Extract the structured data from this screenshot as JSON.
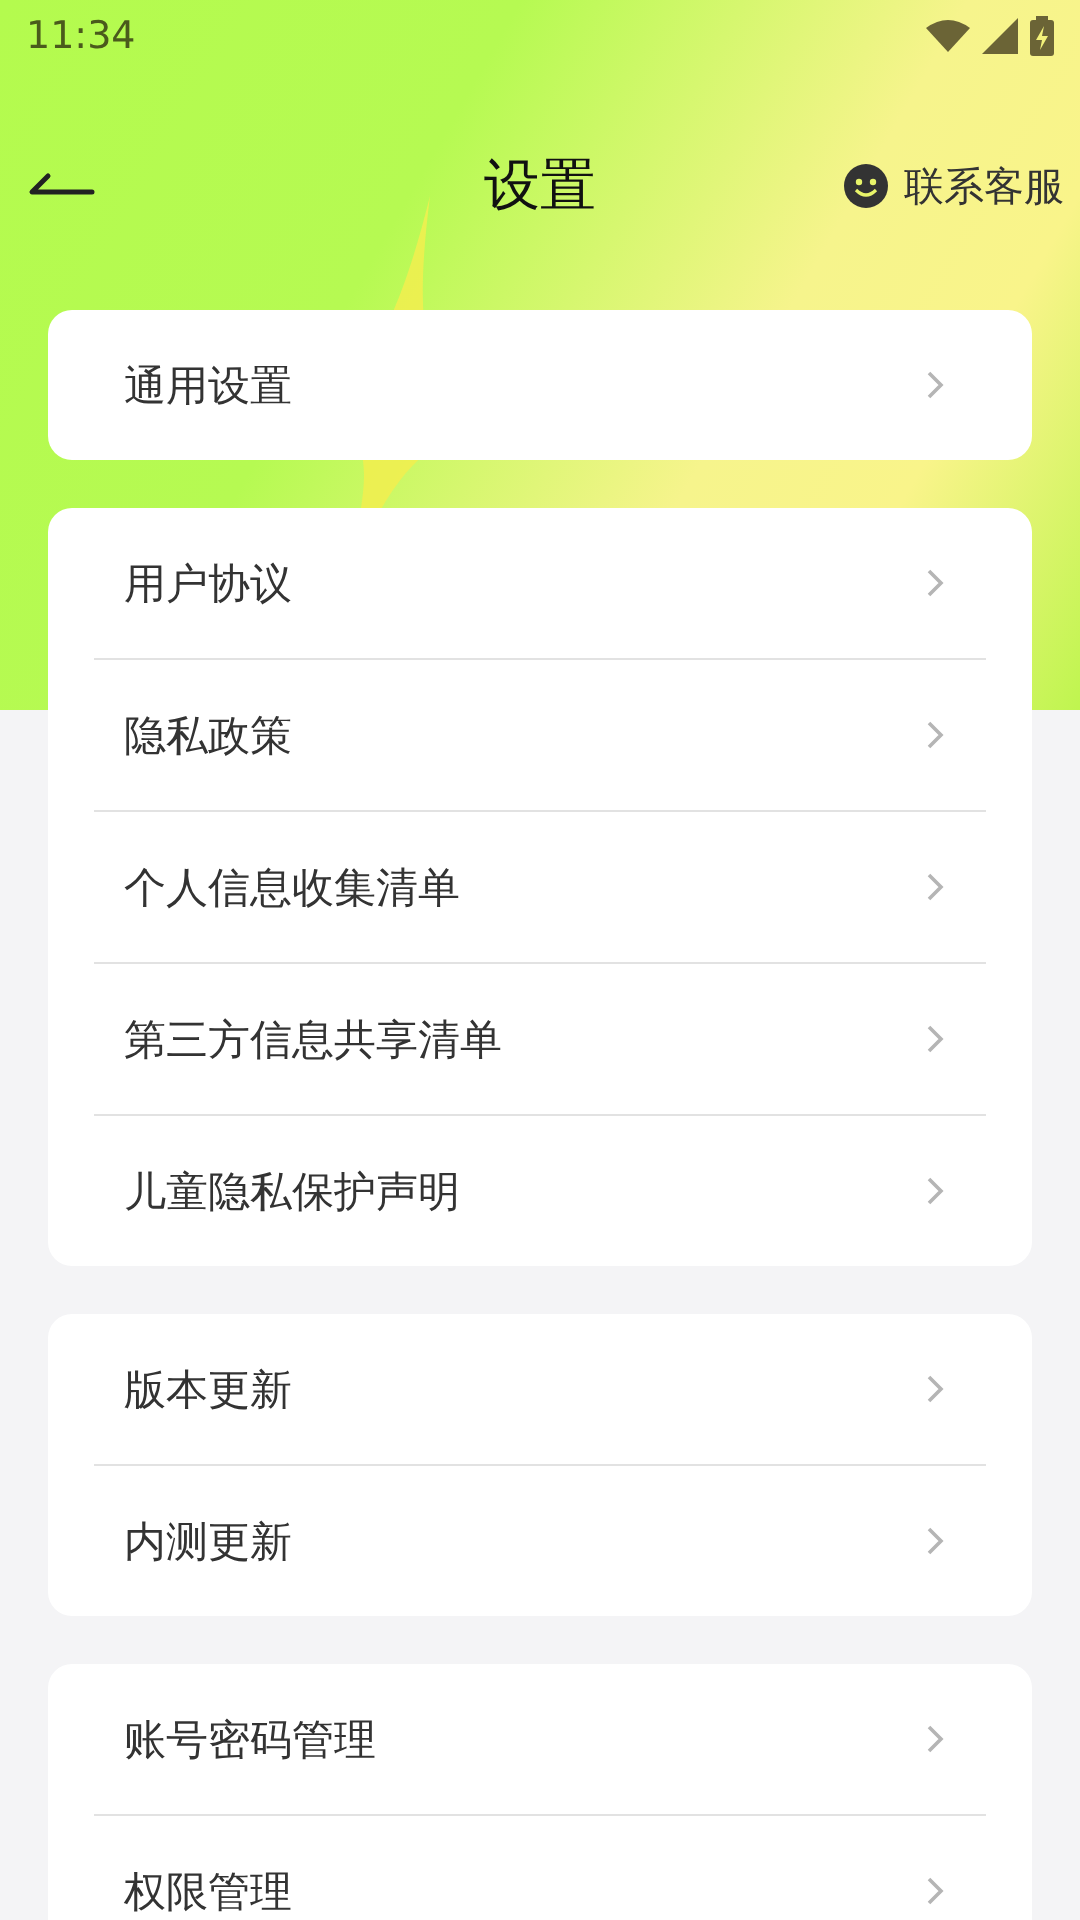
{
  "status_bar": {
    "time": "11:34"
  },
  "header": {
    "title": "设置",
    "contact": "联系客服"
  },
  "groups": [
    {
      "items": [
        {
          "label": "通用设置"
        }
      ]
    },
    {
      "items": [
        {
          "label": "用户协议"
        },
        {
          "label": "隐私政策"
        },
        {
          "label": "个人信息收集清单"
        },
        {
          "label": "第三方信息共享清单"
        },
        {
          "label": "儿童隐私保护声明"
        }
      ]
    },
    {
      "items": [
        {
          "label": "版本更新"
        },
        {
          "label": "内测更新"
        }
      ]
    },
    {
      "items": [
        {
          "label": "账号密码管理"
        },
        {
          "label": "权限管理"
        }
      ]
    }
  ]
}
